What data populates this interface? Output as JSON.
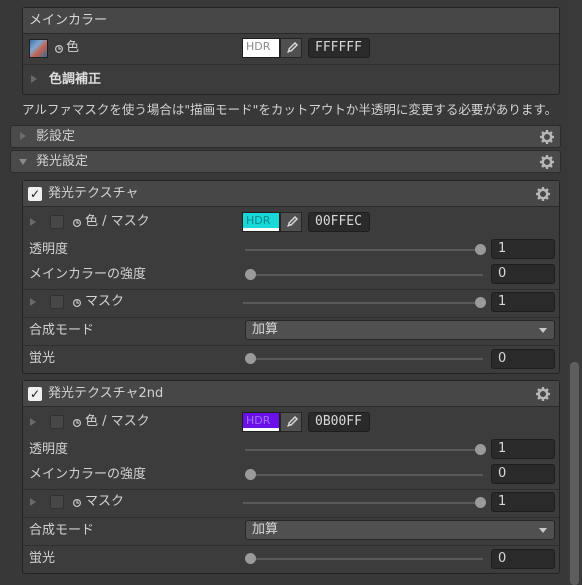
{
  "main_color": {
    "title": "メインカラー",
    "color_label": "色",
    "hdr_label": "HDR",
    "hex": "FFFFFF",
    "color_adjust_label": "色調補正"
  },
  "notice": "アルファマスクを使う場合は\"描画モード\"をカットアウトか半透明に変更する必要があります。",
  "shadow_section": {
    "label": "影設定"
  },
  "emission_section": {
    "label": "発光設定"
  },
  "emission1": {
    "title": "発光テクスチャ",
    "color_mask_label": "色 / マスク",
    "hdr_label": "HDR",
    "swatch_color": "#18d8d8",
    "hex": "00FFEC",
    "opacity_label": "透明度",
    "opacity_value": "1",
    "main_strength_label": "メインカラーの強度",
    "main_strength_value": "0",
    "mask_label": "マスク",
    "mask_value": "1",
    "blend_label": "合成モード",
    "blend_value": "加算",
    "fluor_label": "蛍光",
    "fluor_value": "0"
  },
  "emission2": {
    "title": "発光テクスチャ2nd",
    "color_mask_label": "色 / マスク",
    "hdr_label": "HDR",
    "swatch_color": "#6a10e8",
    "hex": "0B00FF",
    "opacity_label": "透明度",
    "opacity_value": "1",
    "main_strength_label": "メインカラーの強度",
    "main_strength_value": "0",
    "mask_label": "マスク",
    "mask_value": "1",
    "blend_label": "合成モード",
    "blend_value": "加算",
    "fluor_label": "蛍光",
    "fluor_value": "0"
  }
}
